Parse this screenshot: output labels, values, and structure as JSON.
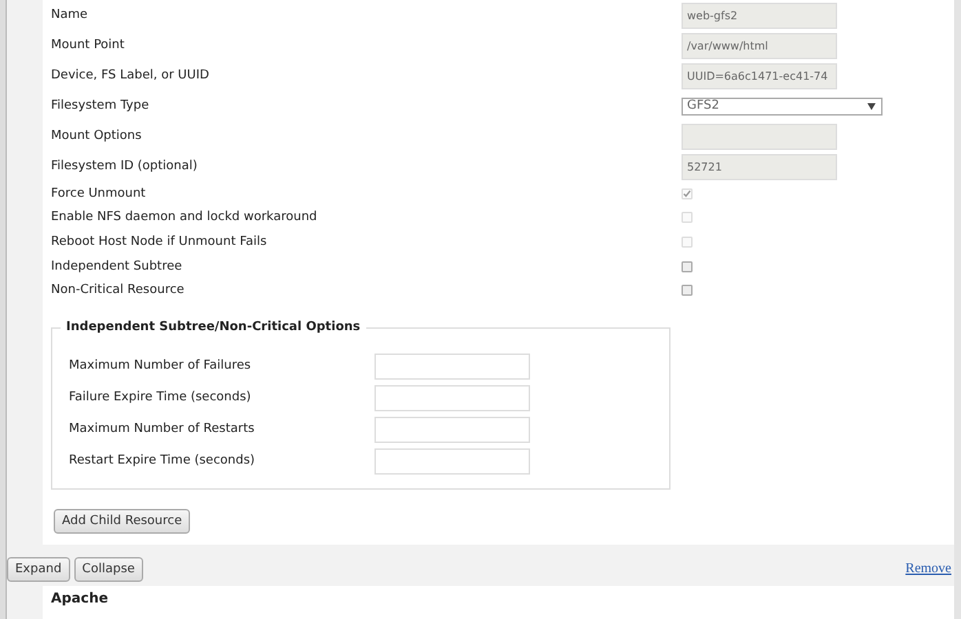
{
  "fields": [
    {
      "kind": "text",
      "label": "Name",
      "value": "web-gfs2",
      "disabled": true
    },
    {
      "kind": "text",
      "label": "Mount Point",
      "value": "/var/www/html",
      "disabled": true
    },
    {
      "kind": "text",
      "label": "Device, FS Label, or UUID",
      "value": "UUID=6a6c1471-ec41-74",
      "disabled": true
    },
    {
      "kind": "select",
      "label": "Filesystem Type",
      "value": "GFS2",
      "disabled": false
    },
    {
      "kind": "text",
      "label": "Mount Options",
      "disabled": true
    },
    {
      "kind": "text",
      "label": "Filesystem ID (optional)",
      "value": "52721",
      "disabled": true
    },
    {
      "kind": "checkbox",
      "label": "Force Unmount",
      "checked": true,
      "disabled": true
    },
    {
      "kind": "checkbox",
      "label": "Enable NFS daemon and lockd workaround",
      "checked": false,
      "disabled": true
    },
    {
      "kind": "checkbox",
      "label": "Reboot Host Node if Unmount Fails",
      "checked": false,
      "disabled": true
    },
    {
      "kind": "checkbox",
      "label": "Independent Subtree",
      "checked": false,
      "disabled": false
    },
    {
      "kind": "checkbox",
      "label": "Non-Critical Resource",
      "checked": false,
      "disabled": false
    }
  ],
  "options": {
    "legend": "Independent Subtree/Non-Critical Options",
    "fields": [
      {
        "label": "Maximum Number of Failures"
      },
      {
        "label": "Failure Expire Time (seconds)"
      },
      {
        "label": "Maximum Number of Restarts"
      },
      {
        "label": "Restart Expire Time (seconds)"
      }
    ]
  },
  "add_child_button": "Add Child Resource",
  "toolbar": {
    "buttons": [
      "Expand",
      "Collapse"
    ],
    "remove_link": "Remove"
  },
  "next_resource": {
    "title": "Apache"
  }
}
